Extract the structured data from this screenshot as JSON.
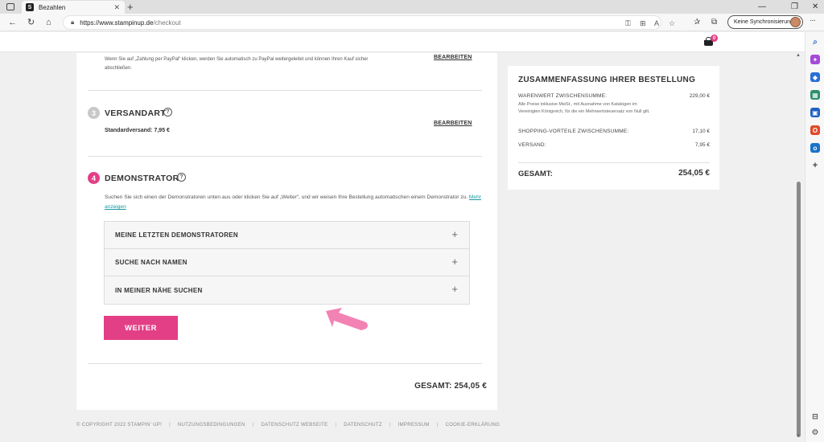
{
  "browser": {
    "tab_title": "Bezahlen",
    "tab_favicon": "S",
    "url_host": "https://www.stampinup.de",
    "url_path": "/checkout",
    "sync_label": "Keine Synchronisierung"
  },
  "header": {
    "cart_count": "0"
  },
  "payment": {
    "info": "Wenn Sie auf „Zahlung per PayPal“ klicken, werden Sie automatisch zu PayPal weitergeleitet und können Ihren Kauf sicher abschließen.",
    "edit_label": "BEARBEITEN"
  },
  "shipping": {
    "number": "3",
    "title": "VERSANDART",
    "method": "Standardversand: 7,95 €",
    "edit_label": "BEARBEITEN"
  },
  "demonstrator": {
    "number": "4",
    "title": "DEMONSTRATOR",
    "description": "Suchen Sie sich einen der Demonstratoren unten aus oder klicken Sie auf „Weiter“, und wir weisen Ihre Bestellung automatischen einem Demonstrator zu.",
    "more_link": "Mehr anzeigen",
    "options": [
      {
        "label": "MEINE LETZTEN DEMONSTRATOREN"
      },
      {
        "label": "SUCHE NACH NAMEN"
      },
      {
        "label": "IN MEINER NÄHE SUCHEN"
      }
    ],
    "continue_label": "WEITER"
  },
  "total_line": "GESAMT: 254,05 €",
  "summary": {
    "title": "ZUSAMMENFASSUNG IHRER BESTELLUNG",
    "subtotal_label": "WARENWERT ZWISCHENSUMME:",
    "subtotal_value": "229,00 €",
    "subtotal_note": "Alle Preise inklusive MwSt., mit Ausnahme von Katalogen im Vereinigten Königreich, für die ein Mehrwertsteuersatz von Null gilt.",
    "shopping_label": "SHOPPING-VORTEILE ZWISCHENSUMME:",
    "shopping_value": "17,10 €",
    "shipping_label": "VERSAND:",
    "shipping_value": "7,95 €",
    "total_label": "GESAMT:",
    "total_value": "254,05 €"
  },
  "footer": {
    "copyright": "© COPYRIGHT 2022 STAMPIN' UP!",
    "links": [
      "NUTZUNGSBEDINGUNGEN",
      "DATENSCHUTZ WEBSEITE",
      "DATENSCHUTZ",
      "IMPRESSUM",
      "COOKIE-ERKLÄRUNG"
    ]
  },
  "colors": {
    "accent": "#e33f86",
    "link": "#1a9aa0",
    "arrow": "#f27bb0"
  }
}
